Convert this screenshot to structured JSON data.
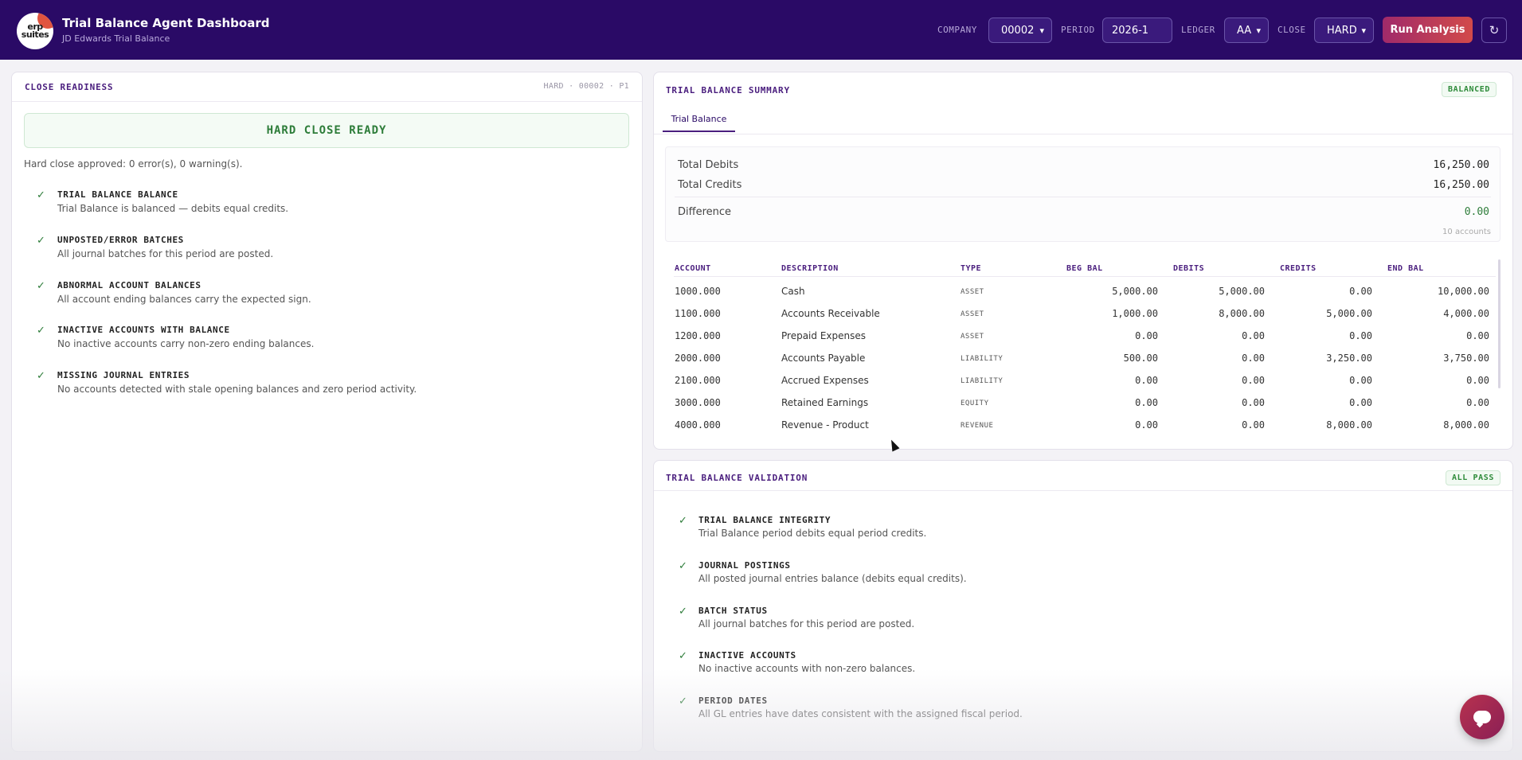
{
  "header": {
    "logo_text_1": "erp",
    "logo_text_2": "suites",
    "title": "Trial Balance Agent Dashboard",
    "subtitle": "JD Edwards Trial Balance",
    "company_label": "COMPANY",
    "company_value": "00002",
    "period_label": "PERIOD",
    "period_value": "2026-1",
    "ledger_label": "LEDGER",
    "ledger_value": "AA",
    "close_label": "CLOSE",
    "close_value": "HARD",
    "run_label": "Run Analysis",
    "refresh_icon": "↻"
  },
  "close_readiness": {
    "title": "CLOSE READINESS",
    "meta": "HARD · 00002 · P1",
    "status": "HARD CLOSE READY",
    "approved_text": "Hard close approved: 0 error(s), 0 warning(s).",
    "checks": [
      {
        "title": "TRIAL BALANCE BALANCE",
        "desc": "Trial Balance is balanced — debits equal credits."
      },
      {
        "title": "UNPOSTED/ERROR BATCHES",
        "desc": "All journal batches for this period are posted."
      },
      {
        "title": "ABNORMAL ACCOUNT BALANCES",
        "desc": "All account ending balances carry the expected sign."
      },
      {
        "title": "INACTIVE ACCOUNTS WITH BALANCE",
        "desc": "No inactive accounts carry non-zero ending balances."
      },
      {
        "title": "MISSING JOURNAL ENTRIES",
        "desc": "No accounts detected with stale opening balances and zero period activity."
      }
    ]
  },
  "summary": {
    "title": "TRIAL BALANCE SUMMARY",
    "badge": "BALANCED",
    "tab": "Trial Balance",
    "total_debits_label": "Total Debits",
    "total_debits": "16,250.00",
    "total_credits_label": "Total Credits",
    "total_credits": "16,250.00",
    "difference_label": "Difference",
    "difference": "0.00",
    "accounts_note": "10 accounts",
    "columns": [
      "ACCOUNT",
      "DESCRIPTION",
      "TYPE",
      "BEG BAL",
      "DEBITS",
      "CREDITS",
      "END BAL"
    ],
    "rows": [
      [
        "1000.000",
        "Cash",
        "ASSET",
        "5,000.00",
        "5,000.00",
        "0.00",
        "10,000.00"
      ],
      [
        "1100.000",
        "Accounts Receivable",
        "ASSET",
        "1,000.00",
        "8,000.00",
        "5,000.00",
        "4,000.00"
      ],
      [
        "1200.000",
        "Prepaid Expenses",
        "ASSET",
        "0.00",
        "0.00",
        "0.00",
        "0.00"
      ],
      [
        "2000.000",
        "Accounts Payable",
        "LIABILITY",
        "500.00",
        "0.00",
        "3,250.00",
        "3,750.00"
      ],
      [
        "2100.000",
        "Accrued Expenses",
        "LIABILITY",
        "0.00",
        "0.00",
        "0.00",
        "0.00"
      ],
      [
        "3000.000",
        "Retained Earnings",
        "EQUITY",
        "0.00",
        "0.00",
        "0.00",
        "0.00"
      ],
      [
        "4000.000",
        "Revenue - Product",
        "REVENUE",
        "0.00",
        "0.00",
        "8,000.00",
        "8,000.00"
      ]
    ]
  },
  "validation": {
    "title": "TRIAL BALANCE VALIDATION",
    "badge": "ALL PASS",
    "checks": [
      {
        "title": "TRIAL BALANCE INTEGRITY",
        "desc": "Trial Balance period debits equal period credits."
      },
      {
        "title": "JOURNAL POSTINGS",
        "desc": "All posted journal entries balance (debits equal credits)."
      },
      {
        "title": "BATCH STATUS",
        "desc": "All journal batches for this period are posted."
      },
      {
        "title": "INACTIVE ACCOUNTS",
        "desc": "No inactive accounts with non-zero balances."
      },
      {
        "title": "PERIOD DATES",
        "desc": "All GL entries have dates consistent with the assigned fiscal period."
      }
    ]
  },
  "colors": {
    "header_bg": "#2a0a66",
    "accent": "#4a1e7e",
    "success": "#2e7d3a"
  }
}
